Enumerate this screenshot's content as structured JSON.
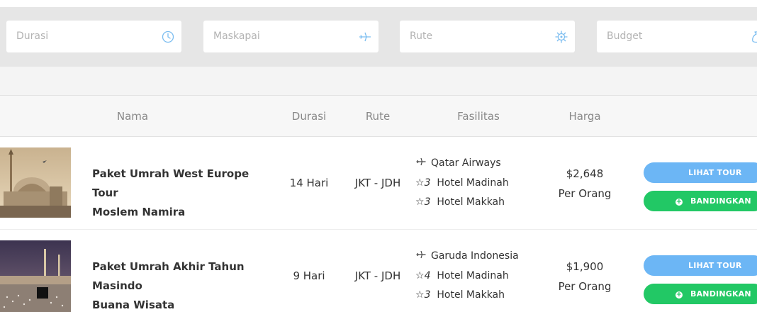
{
  "filters": [
    {
      "placeholder": "Durasi",
      "icon": "clock-icon"
    },
    {
      "placeholder": "Maskapai",
      "icon": "plane-icon"
    },
    {
      "placeholder": "Rute",
      "icon": "compass-icon"
    },
    {
      "placeholder": "Budget",
      "icon": "money-bag-icon"
    }
  ],
  "table": {
    "headers": {
      "nama": "Nama",
      "durasi": "Durasi",
      "rute": "Rute",
      "fasilitas": "Fasilitas",
      "harga": "Harga"
    },
    "rows": [
      {
        "name_line1": "Paket Umrah West Europe Tour",
        "name_line2": "Moslem Namira",
        "durasi": "14 Hari",
        "rute": "JKT - JDH",
        "airline": "Qatar Airways",
        "hotel_madinah_stars": "3",
        "hotel_madinah": "Hotel Madinah",
        "hotel_makkah_stars": "3",
        "hotel_makkah": "Hotel Makkah",
        "price": "$2,648",
        "price_unit": "Per Orang",
        "view_label": "LIHAT TOUR",
        "compare_label": "BANDINGKAN"
      },
      {
        "name_line1": "Paket Umrah Akhir Tahun Masindo",
        "name_line2": "Buana Wisata",
        "durasi": "9 Hari",
        "rute": "JKT - JDH",
        "airline": "Garuda Indonesia",
        "hotel_madinah_stars": "4",
        "hotel_madinah": "Hotel Madinah",
        "hotel_makkah_stars": "3",
        "hotel_makkah": "Hotel Makkah",
        "price": "$1,900",
        "price_unit": "Per Orang",
        "view_label": "LIHAT TOUR",
        "compare_label": "BANDINGKAN"
      }
    ]
  },
  "colors": {
    "accent_blue": "#6cb6f5",
    "accent_green": "#22c865",
    "icon_blue": "#7bbdf0"
  }
}
